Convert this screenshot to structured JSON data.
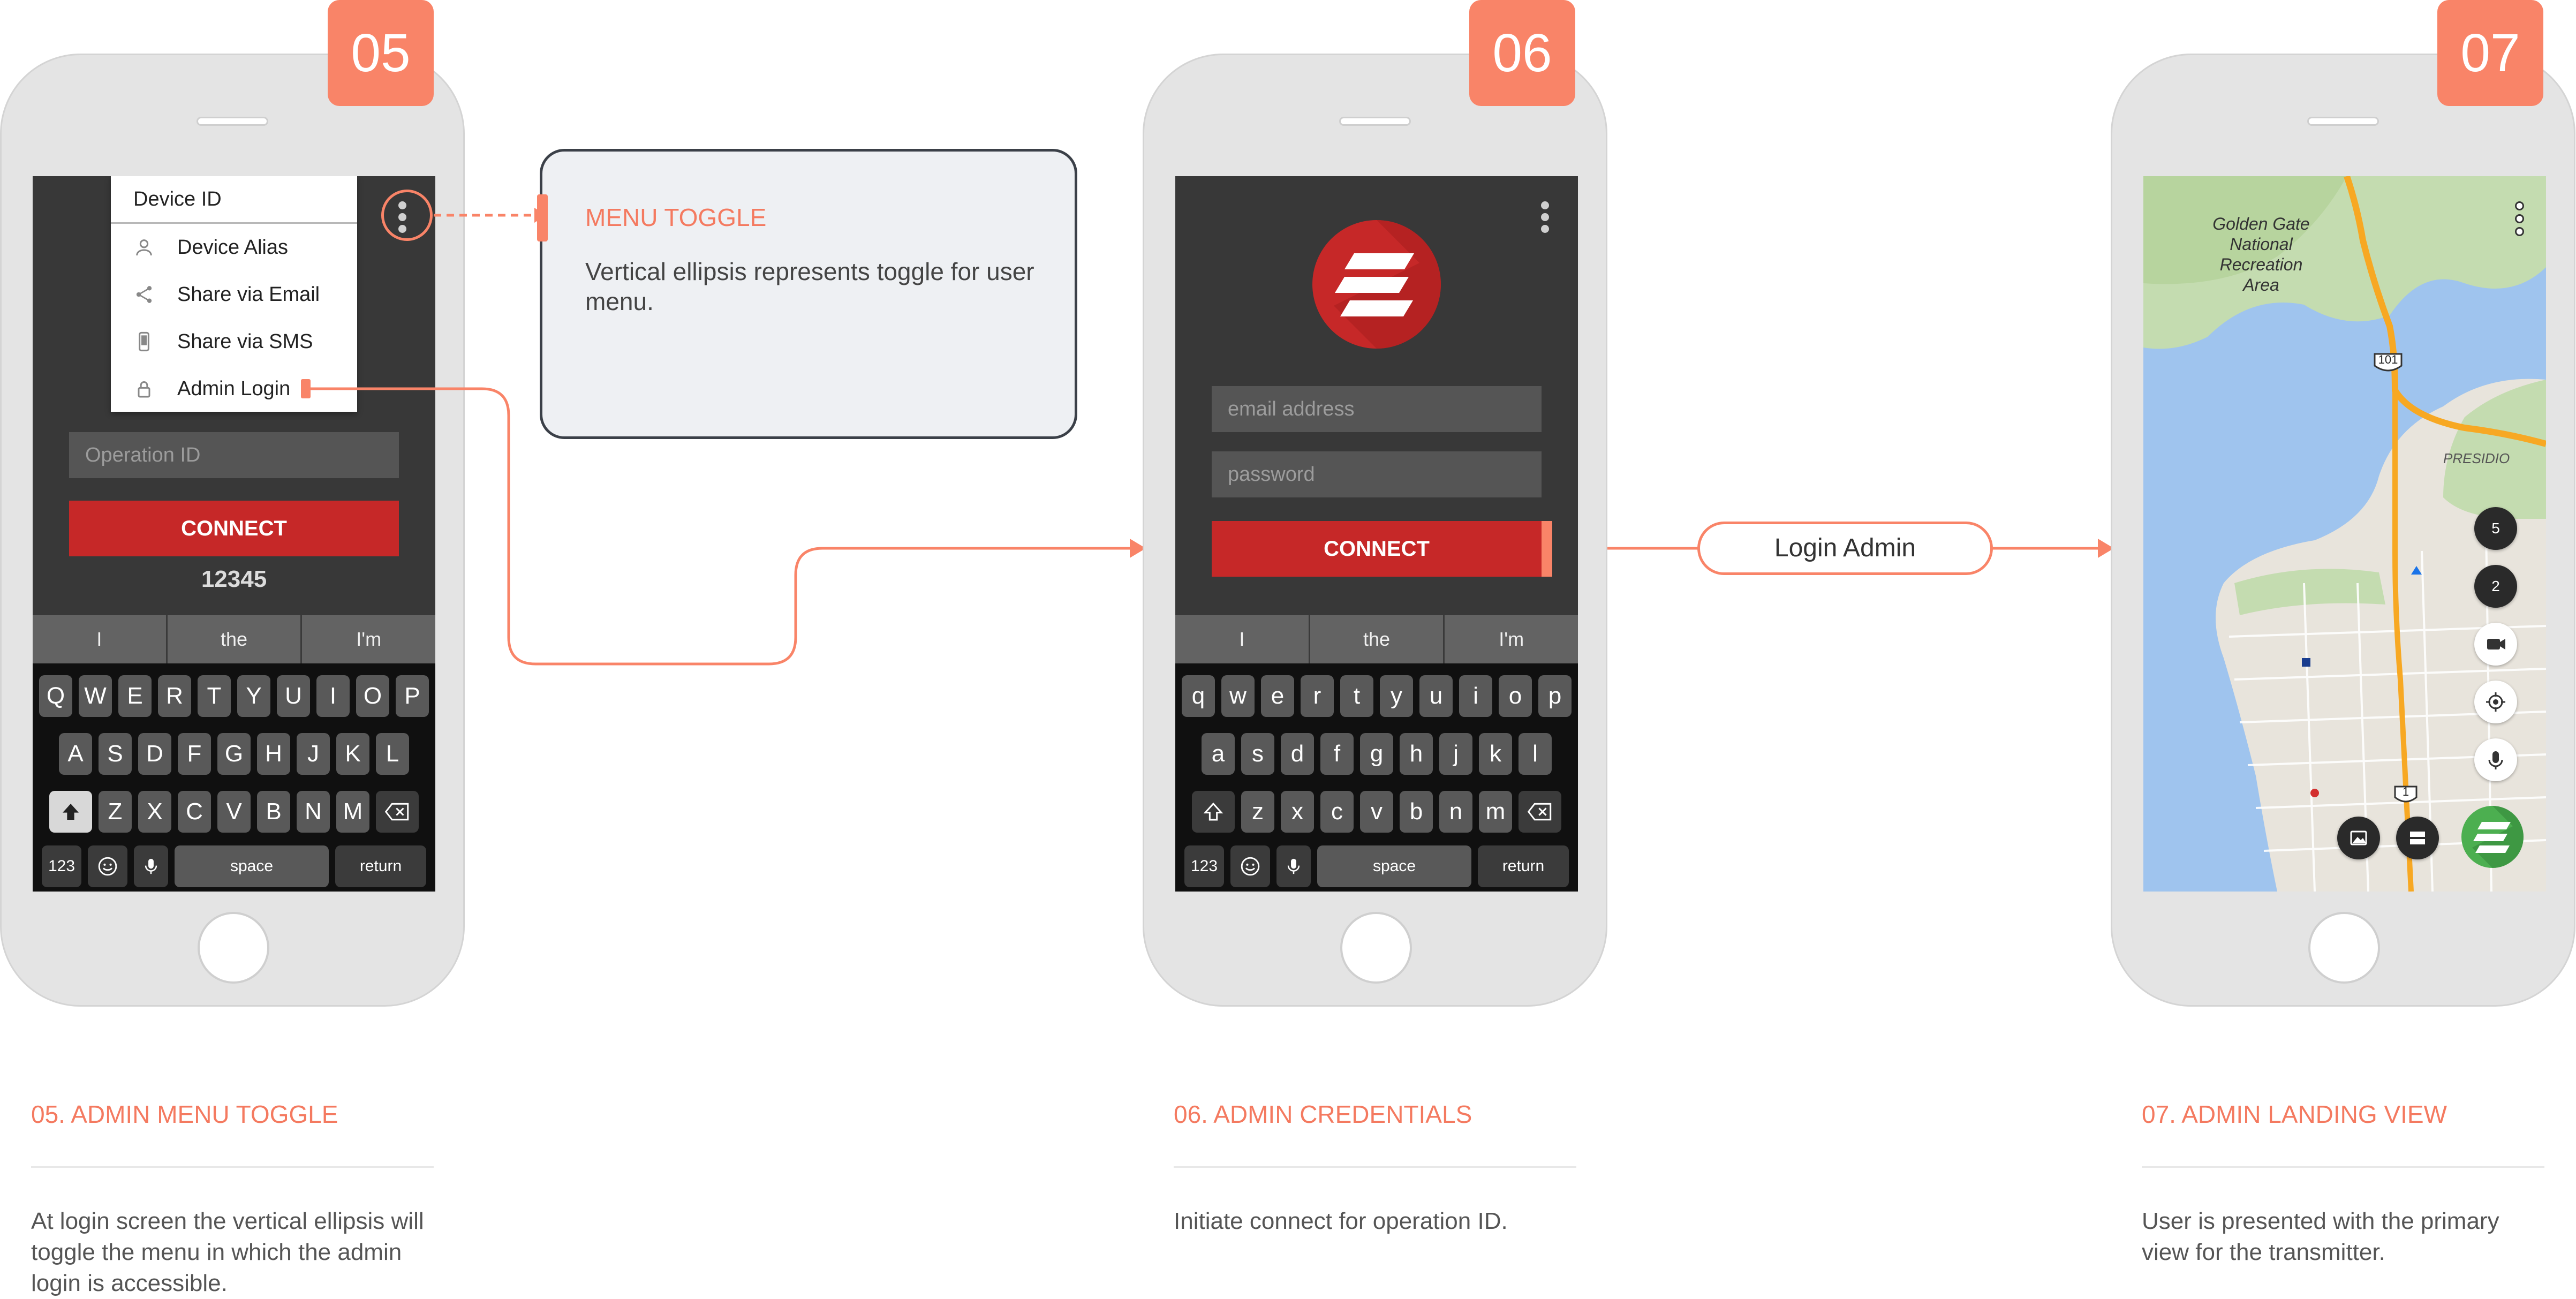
{
  "steps": [
    {
      "badge": "05",
      "caption": "05. ADMIN MENU TOGGLE",
      "description": "At login screen the vertical ellipsis will toggle the menu in which the admin login is accessible."
    },
    {
      "badge": "06",
      "caption": "06. ADMIN CREDENTIALS",
      "description": "Initiate connect for operation ID."
    },
    {
      "badge": "07",
      "caption": "07. ADMIN LANDING VIEW",
      "description": "User is presented with the primary view for the transmitter."
    }
  ],
  "callout": {
    "title": "MENU TOGGLE",
    "body": "Vertical ellipsis represents toggle for user menu."
  },
  "flow_label": "Login Admin",
  "screen05": {
    "menu_header": "Device ID",
    "menu_items": [
      {
        "label": "Device Alias",
        "icon": "person-icon"
      },
      {
        "label": "Share via Email",
        "icon": "share-icon"
      },
      {
        "label": "Share via SMS",
        "icon": "phone-icon"
      },
      {
        "label": "Admin Login",
        "icon": "lock-icon"
      }
    ],
    "operation_placeholder": "Operation ID",
    "connect_label": "CONNECT",
    "operation_value": "12345"
  },
  "screen06": {
    "email_placeholder": "email address",
    "password_placeholder": "password",
    "connect_label": "CONNECT"
  },
  "keyboard": {
    "suggestions": [
      "I",
      "the",
      "I'm"
    ],
    "row1_upper": [
      "Q",
      "W",
      "E",
      "R",
      "T",
      "Y",
      "U",
      "I",
      "O",
      "P"
    ],
    "row2_upper": [
      "A",
      "S",
      "D",
      "F",
      "G",
      "H",
      "J",
      "K",
      "L"
    ],
    "row3_upper": [
      "Z",
      "X",
      "C",
      "V",
      "B",
      "N",
      "M"
    ],
    "row1_lower": [
      "q",
      "w",
      "e",
      "r",
      "t",
      "y",
      "u",
      "i",
      "o",
      "p"
    ],
    "row2_lower": [
      "a",
      "s",
      "d",
      "f",
      "g",
      "h",
      "j",
      "k",
      "l"
    ],
    "row3_lower": [
      "z",
      "x",
      "c",
      "v",
      "b",
      "n",
      "m"
    ],
    "numbers_key": "123",
    "space_key": "space",
    "return_key": "return"
  },
  "screen07": {
    "park_label": "Golden Gate National Recreation Area",
    "district_label": "PRESIDIO",
    "route_101": "101",
    "route_1": "1",
    "counter_1": "5",
    "counter_2": "2"
  },
  "colors": {
    "accent": "#f98468",
    "connect_red": "#c62828",
    "screen_bg": "#383838",
    "logo_green": "#4caf50"
  }
}
